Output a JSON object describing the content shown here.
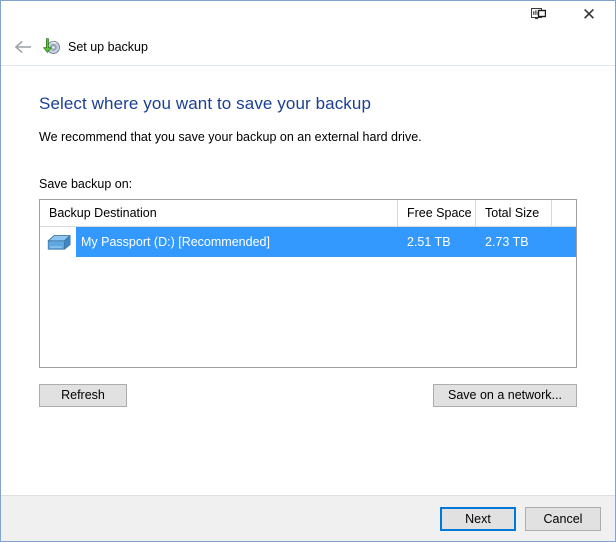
{
  "window": {
    "titlebar": {
      "help_icon": "display-help-icon",
      "close_icon": "close-icon",
      "close_glyph": "✕"
    },
    "nav": {
      "back_icon": "back-arrow-icon",
      "app_icon": "backup-restore-icon",
      "title": "Set up backup"
    }
  },
  "main": {
    "heading": "Select where you want to save your backup",
    "subtext": "We recommend that you save your backup on an external hard drive.",
    "list_label": "Save backup on:"
  },
  "listview": {
    "columns": [
      {
        "key": "destination",
        "label": "Backup Destination"
      },
      {
        "key": "free_space",
        "label": "Free Space"
      },
      {
        "key": "total_size",
        "label": "Total Size"
      }
    ],
    "rows": [
      {
        "icon": "external-hard-drive-icon",
        "destination": "My Passport (D:) [Recommended]",
        "free_space": "2.51 TB",
        "total_size": "2.73 TB",
        "selected": true
      }
    ]
  },
  "buttons": {
    "refresh": "Refresh",
    "save_on_network": "Save on a network...",
    "next": "Next",
    "cancel": "Cancel"
  },
  "colors": {
    "heading_blue": "#1b3f94",
    "selection_blue": "#3399ff",
    "focus_blue": "#0078d7",
    "window_border": "#7fa4ce",
    "footer_bg": "#f0f0f0",
    "button_face": "#e1e1e1"
  }
}
